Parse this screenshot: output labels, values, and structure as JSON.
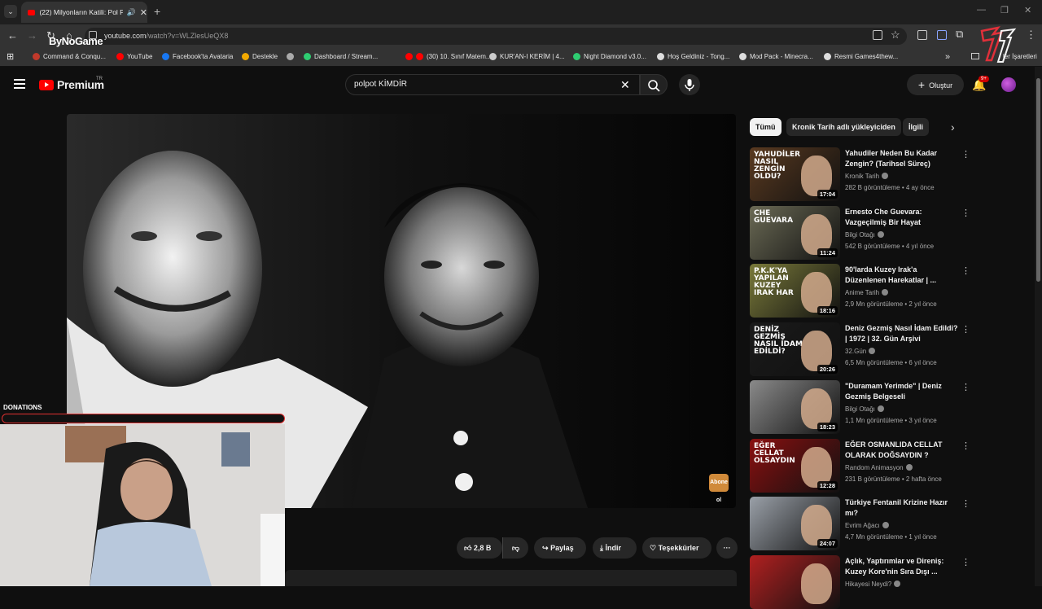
{
  "browser": {
    "tab_title": "(22) Milyonların Katili: Pol P",
    "new_tab": "+",
    "url_host": "youtube.com",
    "url_path": "/watch?v=WLZlesUeQX8",
    "overlay_logo": "ByNoGame",
    "bookmarks": [
      {
        "label": "Command & Conqu...",
        "color": "#c0392b"
      },
      {
        "label": "YouTube",
        "color": "#ff0000"
      },
      {
        "label": "Facebook'ta Avataria",
        "color": "#1877f2"
      },
      {
        "label": "Destekle",
        "color": "#f2a900"
      },
      {
        "label": "",
        "color": "#aaaaaa"
      },
      {
        "label": "Dashboard / Stream...",
        "color": "#2ecc71"
      },
      {
        "label": "",
        "color": "#ff0000"
      },
      {
        "label": "(30) 10. Sınıf Matem...",
        "color": "#ff0000"
      },
      {
        "label": "KUR'AN-I KERİM | 4...",
        "color": "#cccccc"
      },
      {
        "label": "Night Diamond v3.0...",
        "color": "#2ecc71"
      },
      {
        "label": "Hoş Geldiniz - Tong...",
        "color": "#dddddd"
      },
      {
        "label": "Mod Pack - Minecra...",
        "color": "#dddddd"
      },
      {
        "label": "Resmi Games4thew...",
        "color": "#dddddd"
      }
    ],
    "bookmarks_more": "»",
    "all_bookmarks": "ler İşaretleri"
  },
  "youtube": {
    "logo_text": "Premium",
    "logo_region": "TR",
    "search_value": "polpot KİMDİR",
    "create_label": "Oluştur",
    "notif_count": "9+"
  },
  "video": {
    "watermark": "Abone ol"
  },
  "overlay": {
    "donations_label": "DONATIONS"
  },
  "actions": {
    "like_count": "2,8 B",
    "share": "Paylaş",
    "download": "İndir",
    "thanks": "Teşekkürler",
    "more": "···"
  },
  "chips": [
    "Tümü",
    "Kronik Tarih adlı yükleyiciden",
    "İlgili"
  ],
  "recommendations": [
    {
      "title": "Yahudiler Neden Bu Kadar Zengin? (Tarihsel Süreç)",
      "channel": "Kronik Tarih",
      "meta": "282 B görüntüleme • 4 ay önce",
      "duration": "17:04",
      "thumb_text": "YAHUDİLER NASIL ZENGİN OLDU?",
      "thumb_color": "#5a3a20"
    },
    {
      "title": "Ernesto Che Guevara: Vazgeçilmiş Bir Hayat",
      "channel": "Bilgi Otağı",
      "meta": "542 B görüntüleme • 4 yıl önce",
      "duration": "11:24",
      "thumb_text": "CHE GUEVARA",
      "thumb_color": "#6b6a55"
    },
    {
      "title": "90'larda Kuzey Irak'a Düzenlenen Harekatlar | ...",
      "channel": "Anime Tarih",
      "meta": "2,9 Mn görüntüleme • 2 yıl önce",
      "duration": "18:16",
      "thumb_text": "P.K.K'YA YAPILAN KUZEY IRAK HAR",
      "thumb_color": "#7a7a3a"
    },
    {
      "title": "Deniz Gezmiş Nasıl İdam Edildi? | 1972 | 32. Gün Arşivi",
      "channel": "32.Gün",
      "meta": "6,5 Mn görüntüleme • 6 yıl önce",
      "duration": "20:26",
      "thumb_text": "DENİZ GEZMİŞ NASIL İDAM EDİLDİ?",
      "thumb_color": "#1a1a1a"
    },
    {
      "title": "\"Duramam Yerimde\" | Deniz Gezmiş Belgeseli",
      "channel": "Bilgi Otağı",
      "meta": "1,1 Mn görüntüleme • 3 yıl önce",
      "duration": "18:23",
      "thumb_text": "",
      "thumb_color": "#8a8a8a"
    },
    {
      "title": "EĞER OSMANLIDA CELLAT OLARAK DOĞSAYDIN ?",
      "channel": "Random Animasyon",
      "meta": "231 B görüntüleme • 2 hafta önce",
      "duration": "12:28",
      "thumb_text": "EĞER CELLAT OLSAYDIN",
      "thumb_color": "#8a1010"
    },
    {
      "title": "Türkiye Fentanil Krizine Hazır mı?",
      "channel": "Evrim Ağacı",
      "meta": "4,7 Mn görüntüleme • 1 yıl önce",
      "duration": "24:07",
      "thumb_text": "",
      "thumb_color": "#9aa0a8"
    },
    {
      "title": "Açlık, Yaptırımlar ve Direniş: Kuzey Kore'nin Sıra Dışı ...",
      "channel": "Hikayesi Neydi?",
      "meta": "",
      "duration": "",
      "thumb_text": "",
      "thumb_color": "#b02020"
    }
  ]
}
